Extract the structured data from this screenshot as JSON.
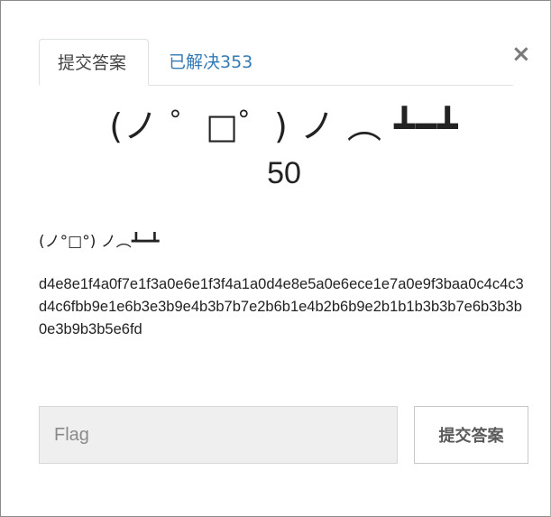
{
  "tabs": {
    "submit_label": "提交答案",
    "solved_label": "已解决353"
  },
  "close_glyph": "×",
  "challenge": {
    "title": "(ノ ゜□゜) ノ ︵ ┻━┻",
    "points": "50",
    "description_title": "(ノ°□°) ノ︵┻━┻",
    "description_hash": "d4e8e1f4a0f7e1f3a0e6e1f3f4a1a0d4e8e5a0e6ece1e7a0e9f3baa0c4c4c3d4c6fbb9e1e6b3e3b9e4b3b7b7e2b6b1e4b2b6b9e2b1b1b3b3b7e6b3b3b0e3b9b3b5e6fd"
  },
  "form": {
    "flag_placeholder": "Flag",
    "flag_value": "",
    "submit_button_label": "提交答案"
  }
}
